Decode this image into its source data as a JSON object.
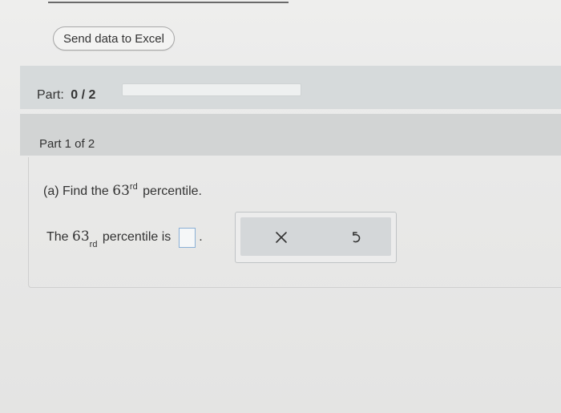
{
  "toolbar": {
    "excel_button_label": "Send data to Excel"
  },
  "part": {
    "label": "Part:",
    "score": "0 / 2",
    "progress": 0
  },
  "step": {
    "label": "Part 1 of 2"
  },
  "question": {
    "prefix": "(a) Find the",
    "number": "63",
    "ordinal": "rd",
    "suffix": "percentile."
  },
  "answer": {
    "prefix": "The",
    "number": "63",
    "ordinal": "rd",
    "suffix": "percentile is",
    "value": "",
    "period": "."
  },
  "actions": {
    "clear_icon": "close-icon",
    "undo_icon": "undo-icon"
  }
}
